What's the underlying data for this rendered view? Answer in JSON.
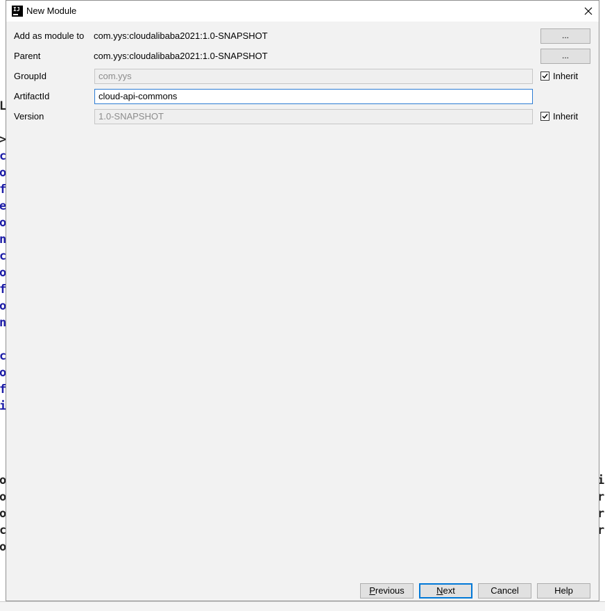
{
  "window": {
    "title": "New Module"
  },
  "form": {
    "add_as_module_to": {
      "label": "Add as module to",
      "value": "com.yys:cloudalibaba2021:1.0-SNAPSHOT",
      "button_label": "..."
    },
    "parent": {
      "label": "Parent",
      "value": "com.yys:cloudalibaba2021:1.0-SNAPSHOT",
      "button_label": "..."
    },
    "group_id": {
      "label": "GroupId",
      "value": "com.yys",
      "inherit_label": "Inherit",
      "inherit_checked": true
    },
    "artifact_id": {
      "label": "ArtifactId",
      "value": "cloud-api-commons"
    },
    "version": {
      "label": "Version",
      "value": "1.0-SNAPSHOT",
      "inherit_label": "Inherit",
      "inherit_checked": true
    }
  },
  "buttons": {
    "previous": {
      "mnemonic": "P",
      "rest": "revious"
    },
    "next": {
      "mnemonic": "N",
      "rest": "ext"
    },
    "cancel": "Cancel",
    "help": "Help"
  },
  "colors": {
    "focus_border": "#2b7bd3",
    "dialog_bg": "#f2f2f2"
  },
  "icons": {
    "app": "intellij-icon",
    "close": "close-icon",
    "check": "checkmark-icon"
  }
}
